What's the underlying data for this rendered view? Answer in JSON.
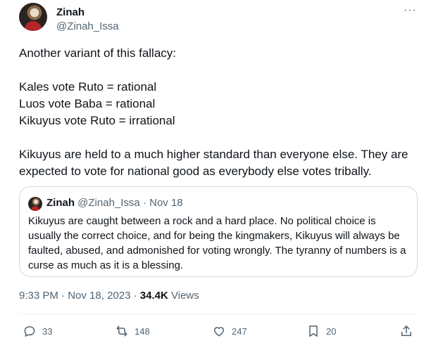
{
  "author": {
    "display_name": "Zinah",
    "handle": "@Zinah_Issa"
  },
  "tweet": {
    "lines": [
      "Another variant of this fallacy:",
      "Kales vote Ruto = rational",
      "Luos vote Baba = rational",
      "Kikuyus vote Ruto = irrational",
      "Kikuyus are held to a much higher standard than everyone else. They are expected to vote for national good as everybody else votes tribally."
    ]
  },
  "quote": {
    "display_name": "Zinah",
    "handle": "@Zinah_Issa",
    "separator": "·",
    "date": "Nov 18",
    "text": "Kikuyus are caught between a rock and a hard place. No political choice is usually the correct choice, and for being the kingmakers, Kikuyus will always be faulted, abused, and admonished for voting wrongly. The tyranny of numbers is a curse as much as it is a blessing."
  },
  "meta": {
    "time": "9:33 PM",
    "separator": "·",
    "date": "Nov 18, 2023",
    "views_count": "34.4K",
    "views_label": "Views"
  },
  "actions": {
    "replies": "33",
    "retweets": "148",
    "likes": "247",
    "bookmarks": "20"
  },
  "menu": {
    "more_label": "···"
  },
  "icons": {
    "more": "more-icon",
    "reply": "reply-icon",
    "retweet": "retweet-icon",
    "like": "heart-icon",
    "bookmark": "bookmark-icon",
    "share": "share-icon"
  }
}
